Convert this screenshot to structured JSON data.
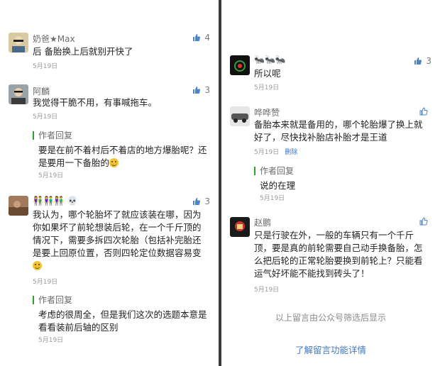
{
  "left": {
    "comments": [
      {
        "nickname": "奶爸★Max",
        "likes": "4",
        "text": "后 备胎换上后就别开快了",
        "date": "5月19日"
      },
      {
        "nickname": "阿麟",
        "likes": "3",
        "text": "我觉得干脆不用，有事喊拖车。",
        "date": "5月19日",
        "reply": {
          "label": "作者回复",
          "text": "要是在前不着村后不着店的地方爆胎呢？还是要用一下备胎的",
          "date": "5月19日"
        }
      },
      {
        "nickname": "👫👫👫 💀",
        "likes": "3",
        "text": "我认为，哪个轮胎坏了就应该装在哪，因为你如果坏了前轮想装后轮，在一个千斤顶的情况下，需要多拆四次轮胎（包括补完胎还是要上回原位置，否则四轮定位数据容易变",
        "date": "5月19日",
        "reply": {
          "label": "作者回复",
          "text": "考虑的很周全，但是我们这次的选题本意是看看装前后轴的区别",
          "date": "5月19日"
        }
      }
    ]
  },
  "right": {
    "comments": [
      {
        "nickname": "🐜🐜🐜",
        "likes": "3",
        "text": "所以呢",
        "date": "5月19日"
      },
      {
        "nickname": "哗哗赞",
        "likes": "",
        "text": "备胎本来就是备用的，哪个轮胎爆了换上就好了，尽快找补胎店补胎才是王道",
        "date": "5月19日",
        "delete_label": "删除",
        "reply": {
          "label": "作者回复",
          "text": "说的在理",
          "date": "5月19日"
        }
      },
      {
        "nickname": "赵鹏",
        "likes": "",
        "text": "只是行驶在外，一般的车辆只有一个千斤顶，要是真的前轮需要自己动手换备胎，怎么把后轮的正常轮胎要换到前轮上？只能看运气好坏能不能找到砖头了！",
        "date": "5月19日"
      }
    ],
    "footer_note": "以上留言由公众号筛选后显示",
    "footer_link": "了解留言功能详情"
  },
  "colors": {
    "link": "#3d78c2",
    "reply_bar": "#2ca02c",
    "divider": "#3a3a3a"
  }
}
